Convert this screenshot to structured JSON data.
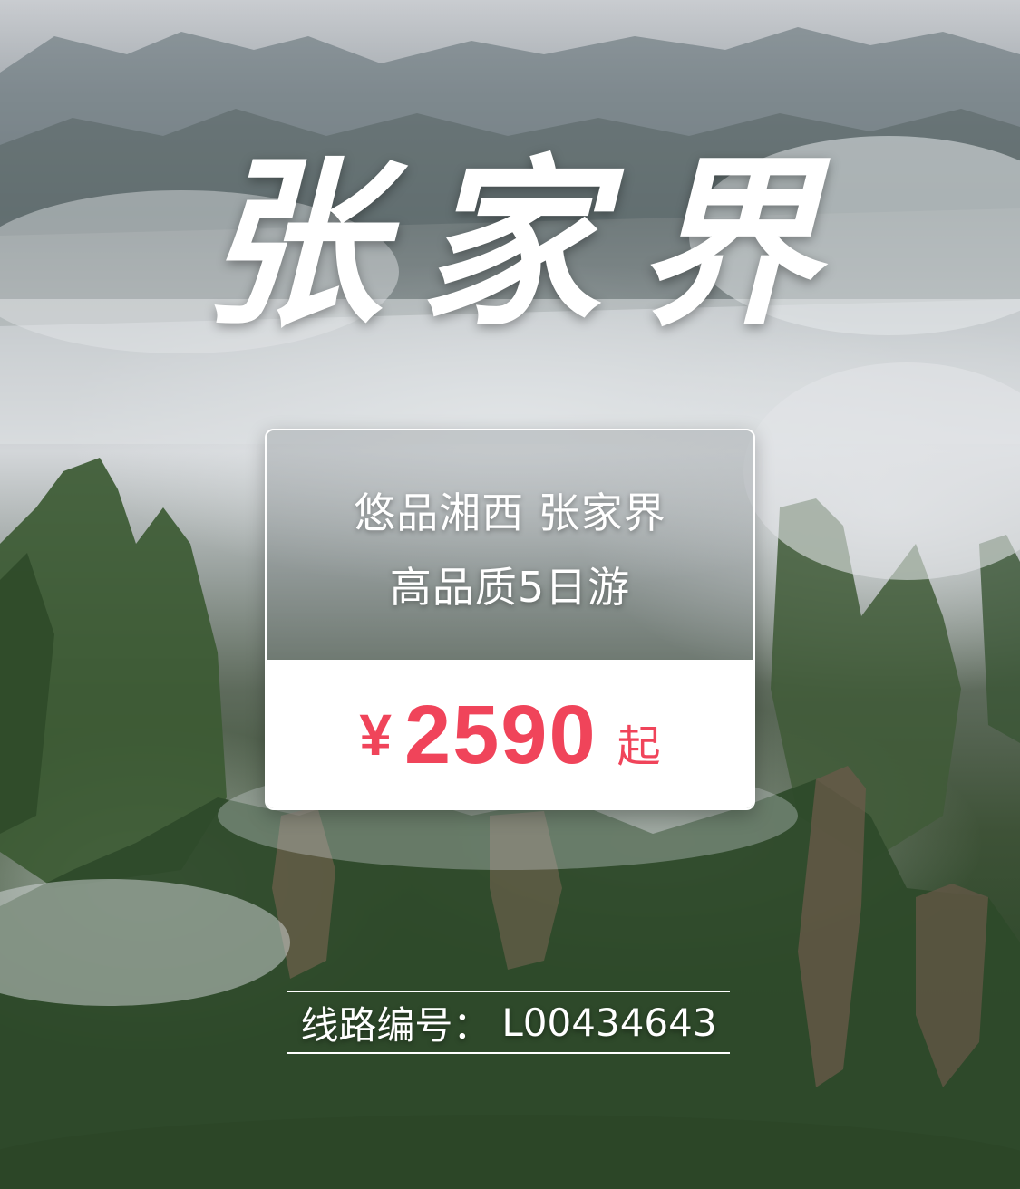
{
  "poster": {
    "title": "张家界",
    "card": {
      "line1": "悠品湘西 张家界",
      "line2": "高品质5日游",
      "currency": "¥",
      "price": "2590",
      "price_suffix": "起"
    },
    "route": {
      "label": "线路编号：",
      "code": "L00434643"
    }
  },
  "colors": {
    "price": "#f0445a",
    "text": "#ffffff"
  }
}
